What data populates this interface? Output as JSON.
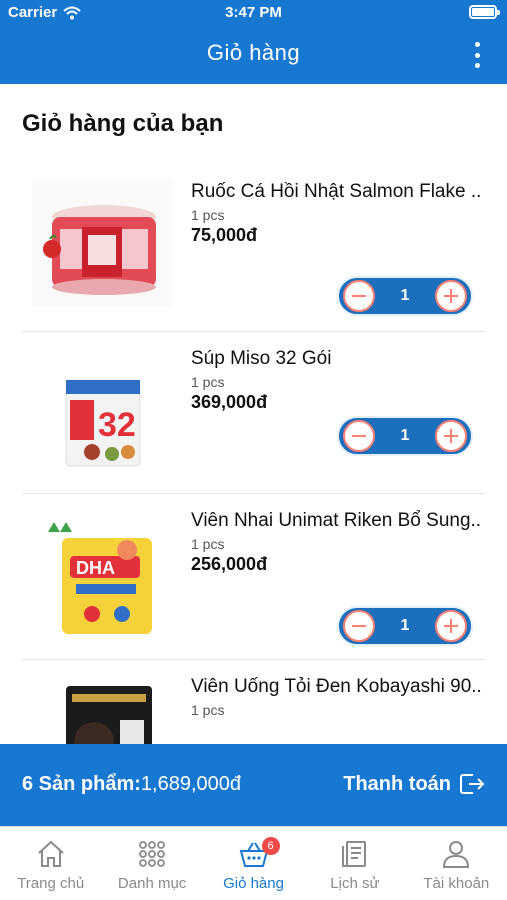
{
  "status_bar": {
    "carrier": "Carrier",
    "time": "3:47 PM"
  },
  "header": {
    "title": "Giỏ hàng"
  },
  "page_title": "Giỏ hàng của bạn",
  "items": [
    {
      "name": "Ruốc Cá Hồi Nhật Salmon Flake ..",
      "unit": "1 pcs",
      "price": "75,000đ",
      "quantity": "1"
    },
    {
      "name": "Súp Miso 32 Gói",
      "unit": "1 pcs",
      "price": "369,000đ",
      "quantity": "1"
    },
    {
      "name": "Viên Nhai Unimat Riken Bổ Sung..",
      "unit": "1 pcs",
      "price": "256,000đ",
      "quantity": "1"
    },
    {
      "name": "Viên Uống Tỏi Đen Kobayashi 90..",
      "unit": "1 pcs"
    }
  ],
  "summary": {
    "count_label": "6 Sản phẩm:",
    "total": "1,689,000đ",
    "checkout_label": "Thanh toán"
  },
  "tabs": [
    {
      "label": "Trang chủ",
      "icon": "home-icon"
    },
    {
      "label": "Danh mục",
      "icon": "grid-icon"
    },
    {
      "label": "Giỏ hàng",
      "icon": "basket-icon",
      "badge": "6",
      "active": true
    },
    {
      "label": "Lịch sử",
      "icon": "history-icon"
    },
    {
      "label": "Tài khoản",
      "icon": "user-icon"
    }
  ],
  "colors": {
    "primary": "#1778d1",
    "stepper": "#1b6fbd",
    "accent": "#ff7f72",
    "badge": "#ef4b4b"
  }
}
